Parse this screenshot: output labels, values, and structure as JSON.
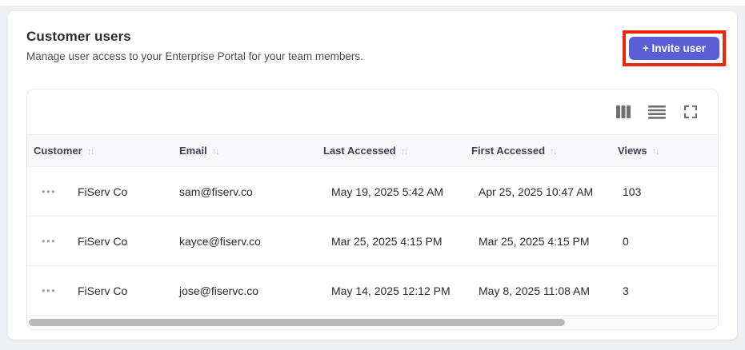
{
  "page": {
    "title": "Customer users",
    "subtitle": "Manage user access to your Enterprise Portal for your team members."
  },
  "actions": {
    "invite_label": "+ Invite user"
  },
  "toolbar": {
    "icons": [
      "columns-icon",
      "row-density-icon",
      "fullscreen-icon"
    ]
  },
  "table": {
    "sort_glyph": "↑↓",
    "row_menu_glyph": "•••",
    "columns": [
      {
        "label": "Customer",
        "sortable": true
      },
      {
        "label": "Email",
        "sortable": true
      },
      {
        "label": "Last Accessed",
        "sortable": true
      },
      {
        "label": "First Accessed",
        "sortable": true
      },
      {
        "label": "Views",
        "sortable": true
      }
    ],
    "rows": [
      {
        "customer": "FiServ Co",
        "email": "sam@fiserv.co",
        "last_accessed": "May 19, 2025 5:42 AM",
        "first_accessed": "Apr 25, 2025 10:47 AM",
        "views": "103"
      },
      {
        "customer": "FiServ Co",
        "email": "kayce@fiserv.co",
        "last_accessed": "Mar 25, 2025 4:15 PM",
        "first_accessed": "Mar 25, 2025 4:15 PM",
        "views": "0"
      },
      {
        "customer": "FiServ Co",
        "email": "jose@fiservc.co",
        "last_accessed": "May 14, 2025 12:12 PM",
        "first_accessed": "May 8, 2025 11:08 AM",
        "views": "3"
      }
    ]
  },
  "colors": {
    "accent": "#5a5fd6",
    "annotation_red": "#e8270b",
    "header_bg": "#f8f8fb",
    "page_bg": "#eef0f3",
    "icon_gray": "#6e6e73",
    "scrollbar_thumb": "#b9b9bd"
  }
}
